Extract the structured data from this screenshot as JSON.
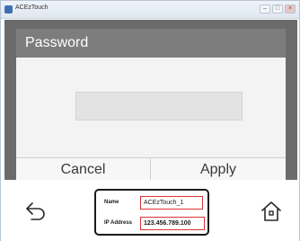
{
  "window": {
    "title": "ACEzTouch",
    "buttons": [
      "–",
      "□",
      "×"
    ]
  },
  "dialog": {
    "title": "Password",
    "password_value": "",
    "cancel_label": "Cancel",
    "apply_label": "Apply"
  },
  "bottom_bar": {
    "back_icon": "back-arrow-icon",
    "home_icon": "home-icon",
    "info": {
      "name_label": "Name",
      "name_value": "ACEzTouch_1",
      "ip_label": "IP Address",
      "ip_value": "123.456.789.100"
    }
  },
  "colors": {
    "dialog_header": "#7d7d7d",
    "overlay": "#6b6b6b",
    "highlight_border": "#dd3333"
  }
}
